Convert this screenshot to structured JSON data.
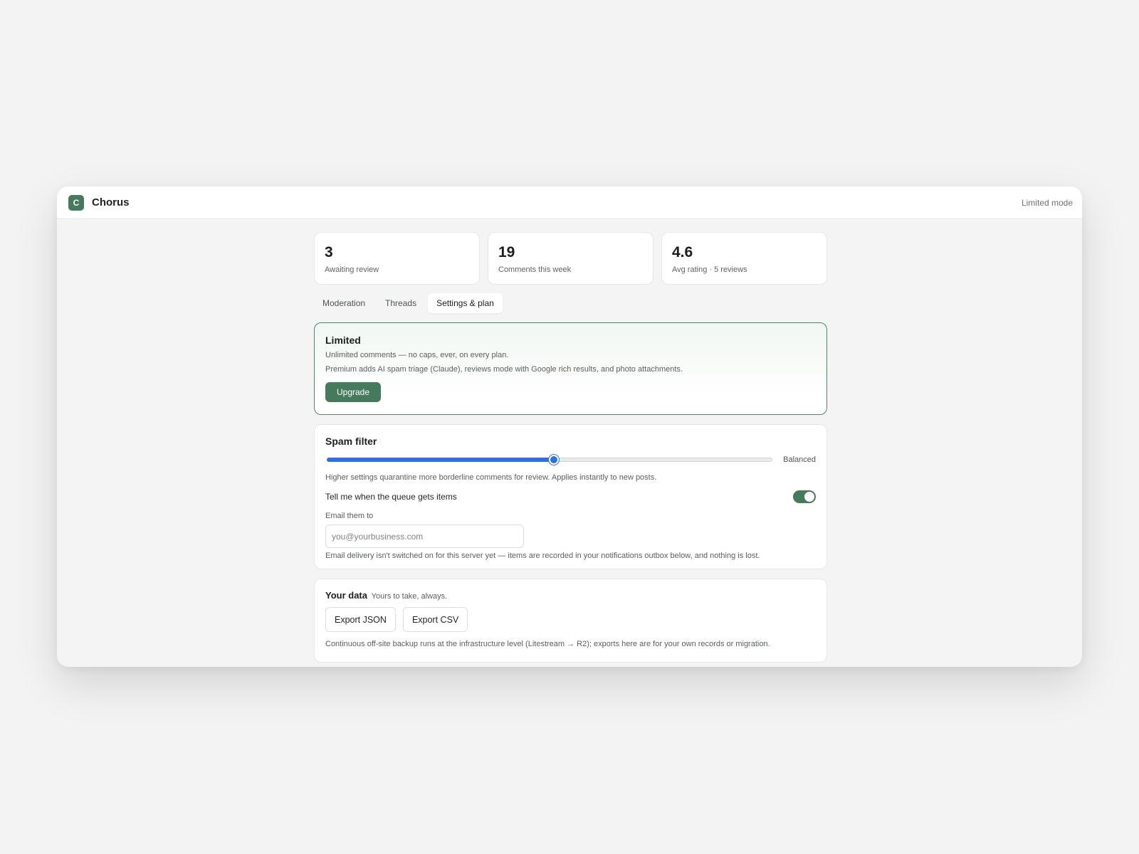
{
  "app": {
    "logo_letter": "C",
    "title": "Chorus",
    "mode": "Limited mode"
  },
  "stats": [
    {
      "value": "3",
      "label": "Awaiting review"
    },
    {
      "value": "19",
      "label": "Comments this week"
    },
    {
      "value": "4.6",
      "label": "Avg rating · 5 reviews"
    }
  ],
  "tabs": [
    {
      "label": "Moderation",
      "active": false
    },
    {
      "label": "Threads",
      "active": false
    },
    {
      "label": "Settings & plan",
      "active": true
    }
  ],
  "plan": {
    "title": "Limited",
    "line1": "Unlimited comments — no caps, ever, on every plan.",
    "line2": "Premium adds AI spam triage (Claude), reviews mode with Google rich results, and photo attachments.",
    "upgrade_label": "Upgrade"
  },
  "spam": {
    "title": "Spam filter",
    "slider_level": 0.51,
    "slider_value_label": "Balanced",
    "help": "Higher settings quarantine more borderline comments for review. Applies instantly to new posts.",
    "toggle_label": "Tell me when the queue gets items",
    "toggle_on": true,
    "email_label": "Email them to",
    "email_placeholder": "you@yourbusiness.com",
    "email_value": "",
    "email_help": "Email delivery isn't switched on for this server yet — items are recorded in your notifications outbox below, and nothing is lost."
  },
  "data_section": {
    "title": "Your data",
    "subtitle": "Yours to take, always.",
    "export_json_label": "Export JSON",
    "export_csv_label": "Export CSV",
    "help": "Continuous off-site backup runs at the infrastructure level (Litestream → R2); exports here are for your own records or migration."
  },
  "colors": {
    "brand_green": "#467a5c",
    "slider_blue": "#2e6fe5",
    "background": "#f2f3f2"
  }
}
